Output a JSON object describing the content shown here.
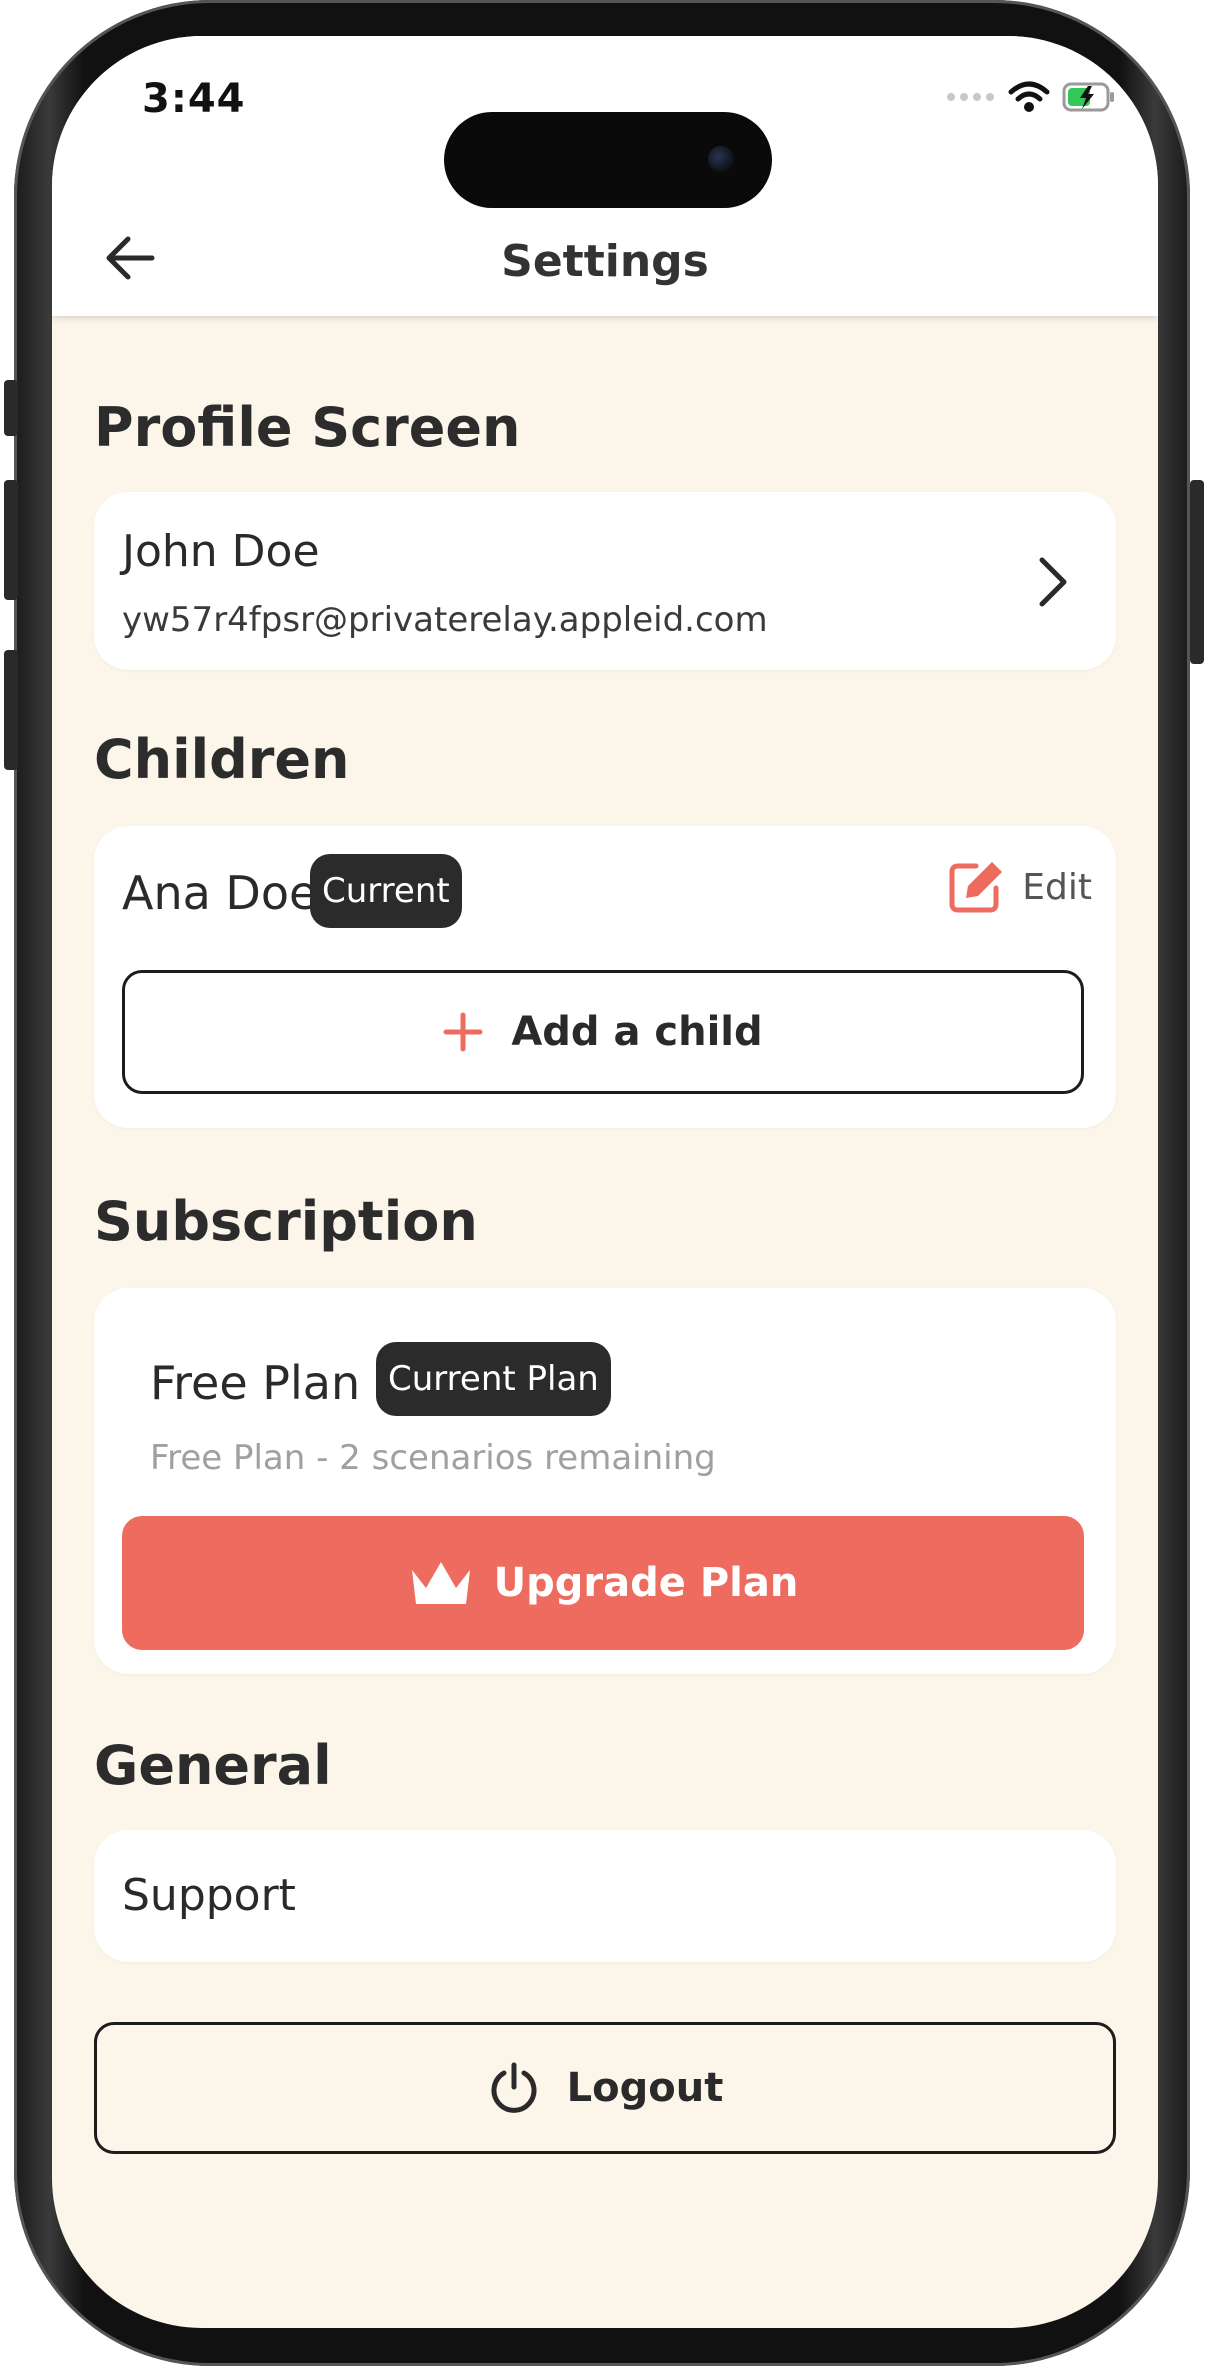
{
  "status_bar": {
    "time": "3:44"
  },
  "header": {
    "title": "Settings",
    "back_icon": "arrow-left-icon"
  },
  "profile": {
    "section_title": "Profile Screen",
    "name": "John Doe",
    "email": "yw57r4fpsr@privaterelay.appleid.com"
  },
  "children": {
    "section_title": "Children",
    "items": [
      {
        "name": "Ana Doe",
        "badge": "Current",
        "edit_label": "Edit"
      }
    ],
    "add_label": "Add a child"
  },
  "subscription": {
    "section_title": "Subscription",
    "plan_name": "Free Plan",
    "plan_badge": "Current Plan",
    "plan_description": "Free Plan - 2 scenarios remaining",
    "upgrade_label": "Upgrade Plan"
  },
  "general": {
    "section_title": "General",
    "items": [
      {
        "label": "Support"
      }
    ]
  },
  "logout_label": "Logout",
  "colors": {
    "accent": "#EE6B5F",
    "background": "#FCF5EA",
    "badge": "#2B2B2B"
  }
}
